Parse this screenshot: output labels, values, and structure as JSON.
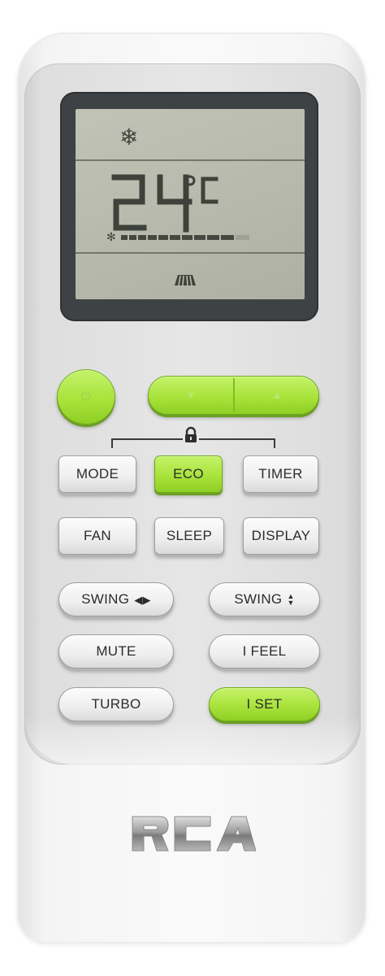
{
  "lcd": {
    "mode_icon": "snowflake-icon",
    "temperature": "24",
    "unit": "°C",
    "fan_level": 0.8,
    "swing_icon": "swing-louver-icon"
  },
  "controls": {
    "power_icon": "power-icon",
    "temp_down_icon": "chevron-down-icon",
    "temp_up_icon": "chevron-up-icon",
    "lock_icon": "padlock-icon"
  },
  "buttons": {
    "mode": "MODE",
    "eco": "ECO",
    "timer": "TIMER",
    "fan": "FAN",
    "sleep": "SLEEP",
    "display": "DISPLAY",
    "swing_h": "SWING",
    "swing_v": "SWING",
    "mute": "MUTE",
    "ifeel": "I FEEL",
    "turbo": "TURBO",
    "iset": "I SET"
  },
  "brand": {
    "logo": "RCA"
  },
  "colors": {
    "accent_green": "#a9e33b",
    "lcd_background": "#b9bbae",
    "lcd_frame": "#3e4244",
    "body": "#f4f4f4"
  }
}
